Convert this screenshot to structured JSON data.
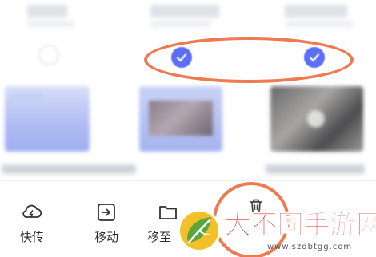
{
  "selection": {
    "checked_count": 2
  },
  "toolbar": {
    "quick_share_label": "快传",
    "move_label": "移动",
    "move_to_label": "移至"
  },
  "watermark": {
    "title": "大不同手游网",
    "url": "www.szdbtgg.com"
  },
  "colors": {
    "accent": "#5b6ef5",
    "highlight": "#ee7a52",
    "watermark_red": "#d62b2b"
  }
}
